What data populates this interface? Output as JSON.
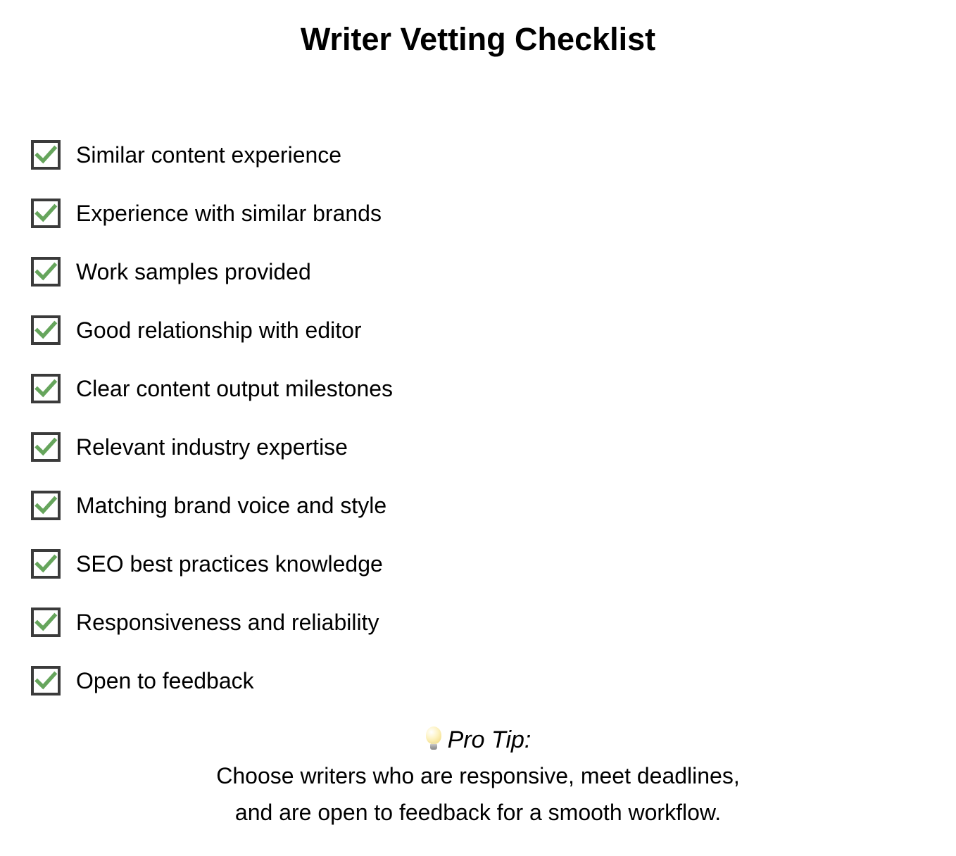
{
  "page": {
    "title": "Writer Vetting Checklist",
    "background_color": "#ffffff",
    "text_color": "#000000"
  },
  "checklist": {
    "checkbox_state": "checked",
    "checkbox_border_color": "#3b3b3b",
    "checkbox_fill_color": "#ffffff",
    "check_color": "#66a55c",
    "items": [
      {
        "label": "Similar content experience",
        "checked": true
      },
      {
        "label": "Experience with similar brands",
        "checked": true
      },
      {
        "label": "Work samples provided",
        "checked": true
      },
      {
        "label": "Good relationship with editor",
        "checked": true
      },
      {
        "label": "Clear content output milestones",
        "checked": true
      },
      {
        "label": "Relevant industry expertise",
        "checked": true
      },
      {
        "label": "Matching brand voice and style",
        "checked": true
      },
      {
        "label": "SEO best practices knowledge",
        "checked": true
      },
      {
        "label": "Responsiveness and reliability",
        "checked": true
      },
      {
        "label": "Open to feedback",
        "checked": true
      }
    ]
  },
  "pro_tip": {
    "icon": "lightbulb-icon",
    "heading": "Pro Tip:",
    "lines": [
      "Choose writers who are responsive, meet deadlines,",
      "and are open to feedback for a smooth workflow."
    ]
  }
}
